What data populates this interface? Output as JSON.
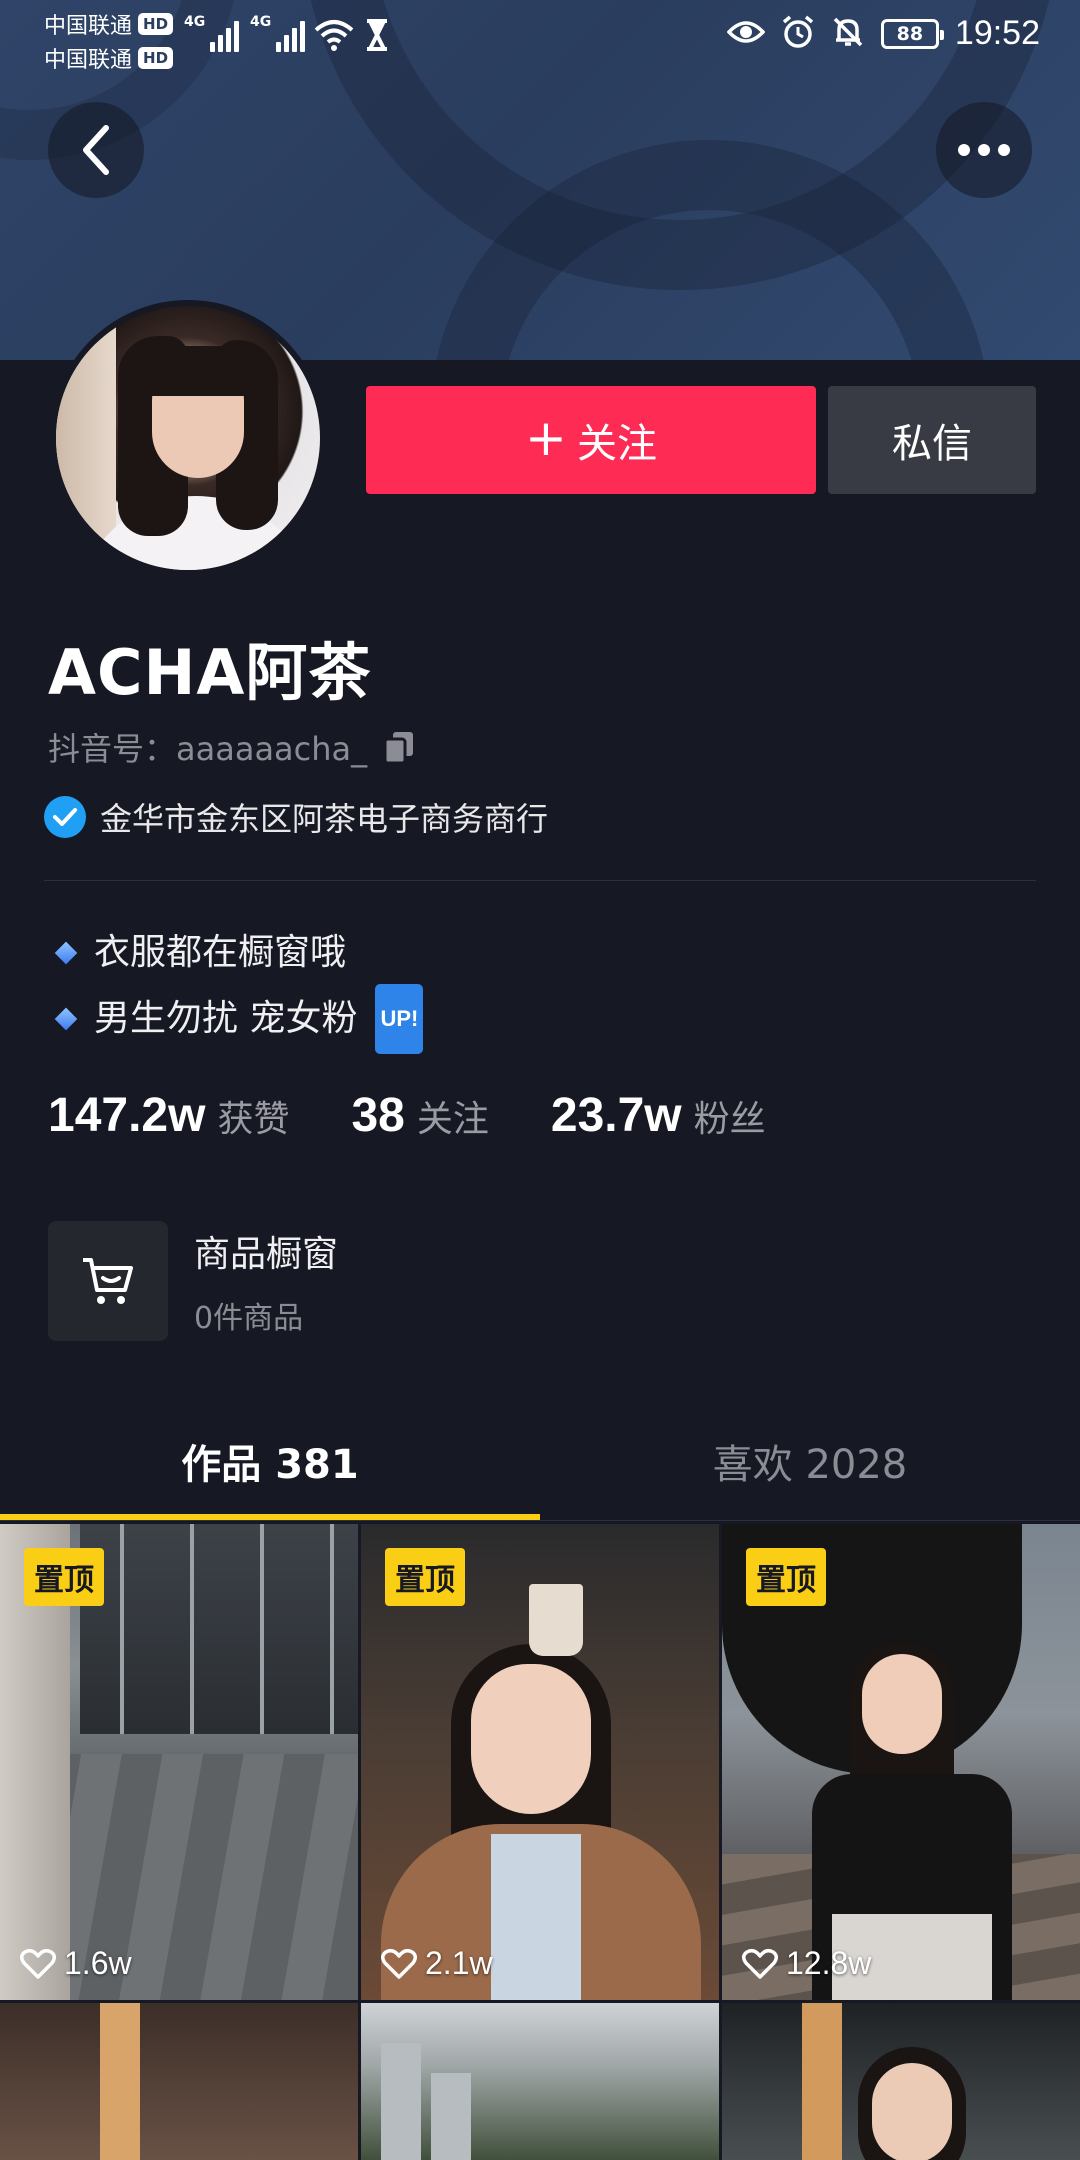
{
  "status_bar": {
    "carrier_1": "中国联通",
    "carrier_2": "中国联通",
    "hd": "HD",
    "network": "4G",
    "battery": "88",
    "time": "19:52"
  },
  "nav": {
    "back_icon": "chevron-left-icon",
    "more_icon": "more-dots-icon"
  },
  "actions": {
    "follow_plus": "+",
    "follow_label": "关注",
    "message_label": "私信"
  },
  "profile": {
    "name": "ACHA阿茶",
    "douyin_id": "抖音号：aaaaaacha_",
    "verification": "金华市金东区阿茶电子商务商行",
    "bio": [
      "衣服都在橱窗哦",
      "男生勿扰 宠女粉"
    ],
    "bio_badge": "UP!"
  },
  "stats": [
    {
      "value": "147.2w",
      "label": "获赞"
    },
    {
      "value": "38",
      "label": "关注"
    },
    {
      "value": "23.7w",
      "label": "粉丝"
    }
  ],
  "shop": {
    "title": "商品橱窗",
    "subtitle": "0件商品",
    "icon": "cart-icon"
  },
  "tabs": [
    {
      "label": "作品 381",
      "active": true
    },
    {
      "label": "喜欢 2028",
      "active": false
    }
  ],
  "videos": [
    {
      "pinned": "置顶",
      "likes": "1.6w"
    },
    {
      "pinned": "置顶",
      "likes": "2.1w"
    },
    {
      "pinned": "置顶",
      "likes": "12.8w"
    }
  ],
  "colors": {
    "background": "#161823",
    "follow": "#fe2c55",
    "accent_yellow": "#face15",
    "verified_blue": "#20a0f5"
  }
}
